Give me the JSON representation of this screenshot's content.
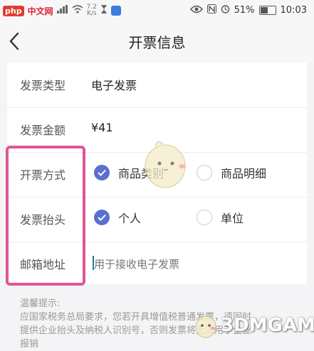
{
  "status_bar": {
    "left": {
      "logo": "php",
      "site": "中文网",
      "speed_value": "7.2",
      "speed_unit": "K/s"
    },
    "right": {
      "battery_text": "51%",
      "time": "10:03"
    },
    "icons": [
      "signal-icon",
      "wifi-icon",
      "hourglass-icon",
      "app-icon",
      "eye-icon",
      "nfc-icon",
      "alarm-icon",
      "battery-icon"
    ]
  },
  "header": {
    "title": "开票信息"
  },
  "form": {
    "invoice_type": {
      "label": "发票类型",
      "value": "电子发票"
    },
    "invoice_amount": {
      "label": "发票金额",
      "value": "¥41"
    },
    "invoice_method": {
      "label": "开票方式",
      "options": [
        {
          "label": "商品类别",
          "checked": true
        },
        {
          "label": "商品明细",
          "checked": false
        }
      ]
    },
    "invoice_title": {
      "label": "发票抬头",
      "options": [
        {
          "label": "个人",
          "checked": true
        },
        {
          "label": "单位",
          "checked": false
        }
      ]
    },
    "email": {
      "label": "邮箱地址",
      "placeholder": "用于接收电子发票"
    }
  },
  "tips": {
    "title": "温馨提示:",
    "line1": "应国家税务总局要求，您若开具增值税普通发票，须同时",
    "line2": "提供企业抬头及纳税人识别号，否则发票将无法用于企业",
    "line3": "报销"
  },
  "watermark": {
    "text": "3DMGAME"
  },
  "colors": {
    "accent": "#5a6fcf",
    "highlight": "#e05592",
    "background": "#f4f4f6"
  }
}
